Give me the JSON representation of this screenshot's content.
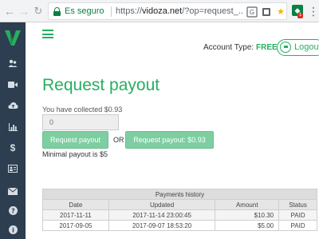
{
  "browser": {
    "secure_label": "Es seguro",
    "url_protocol": "https://",
    "url_host": "vidoza.net",
    "url_path": "/?op=request_...",
    "extension_badge": "1",
    "icons": [
      "back-arrow-icon",
      "forward-arrow-icon",
      "reload-icon",
      "lock-icon",
      "translate-icon",
      "extension-icon",
      "star-icon",
      "menu-dots-icon"
    ]
  },
  "sidebar": {
    "logo_letter": "V",
    "items": [
      {
        "icon": "users-icon"
      },
      {
        "icon": "video-camera-icon"
      },
      {
        "icon": "cloud-upload-icon"
      },
      {
        "icon": "bar-chart-icon"
      },
      {
        "icon": "dollar-icon"
      },
      {
        "icon": "id-card-icon"
      },
      {
        "icon": "envelope-icon"
      },
      {
        "icon": "help-icon"
      },
      {
        "icon": "info-icon"
      }
    ]
  },
  "header": {
    "account_type_label": "Account Type:",
    "account_type_value": "FREE",
    "logout_label": "Logout"
  },
  "page": {
    "title": "Request payout",
    "collected_text": "You have collected $0.93",
    "amount_placeholder": "0",
    "request_button": "Request payout",
    "or_text": "OR",
    "request_amount_button": "Request payout: $0.93",
    "minimal_text": "Minimal payout is $5"
  },
  "history": {
    "caption": "Payments history",
    "columns": [
      "Date",
      "Updated",
      "Amount",
      "Status"
    ],
    "rows": [
      [
        "2017-11-11",
        "2017-11-14 23:00:45",
        "$10.30",
        "PAID"
      ],
      [
        "2017-09-05",
        "2017-09-07 18:53:20",
        "$5.00",
        "PAID"
      ]
    ]
  },
  "colors": {
    "accent": "#27ae60",
    "sidebar_bg": "#2c3e50",
    "button_bg": "#7dcea0"
  }
}
